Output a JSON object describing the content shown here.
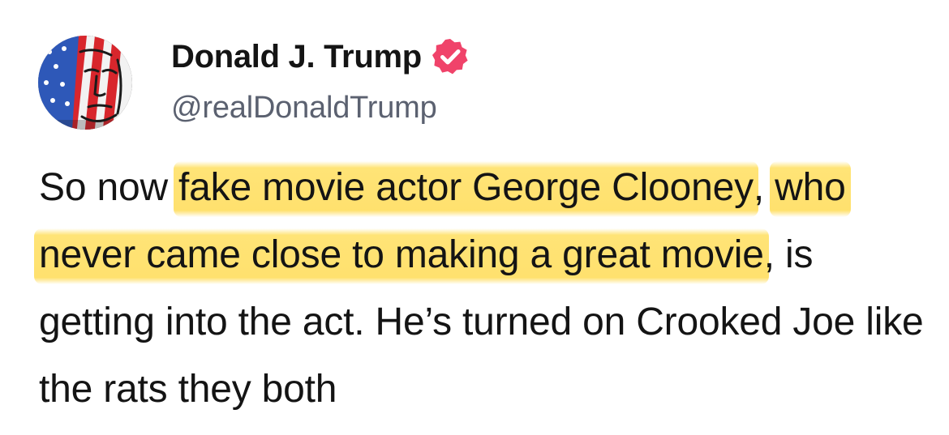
{
  "post": {
    "author": {
      "display_name": "Donald J. Trump",
      "handle": "@realDonaldTrump",
      "verified": true,
      "verified_badge_color": "#f0436a",
      "avatar_icon": "flag-portrait-avatar"
    },
    "text": {
      "part1": "So now ",
      "part2_highlighted": "fake movie actor George Clooney",
      "part3": ", ",
      "part4_highlighted": "who never came close to making a great movie",
      "part5": ", is getting into the act. He’s turned on Crooked Joe like the rats they both"
    },
    "highlight_color": "#ffd84e"
  }
}
